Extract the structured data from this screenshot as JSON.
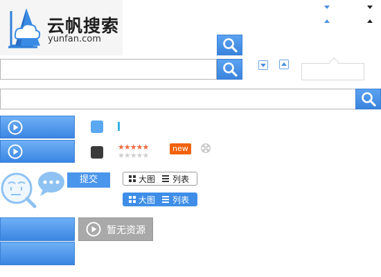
{
  "logo": {
    "name_cn": "云帆搜索",
    "domain": "yunfan.com",
    "icon": "sail-cloud-logo"
  },
  "search_bars": {
    "small_icon": "search-icon",
    "main_icon": "search-icon",
    "wide_icon": "search-icon"
  },
  "arrows": {
    "icons": [
      "triangle-down-icon",
      "triangle-up-icon",
      "caret-down-icon",
      "caret-up-icon"
    ]
  },
  "rating": {
    "stars_filled": 5,
    "stars_total": 5,
    "filled_glyph": "★★★★★",
    "empty_glyph": "★★★★★"
  },
  "badge": {
    "new_label": "new"
  },
  "colors": {
    "accent": "#3b84dd",
    "badge": "#f2620b",
    "star": "#ee6b3c",
    "swatch_blue": "#5aa7f2",
    "swatch_dark": "#3a3a3a"
  },
  "submit": {
    "label": "提交"
  },
  "view_toggle": {
    "grid_label": "大图",
    "list_label": "列表"
  },
  "no_resource": {
    "label": "暂无资源"
  }
}
